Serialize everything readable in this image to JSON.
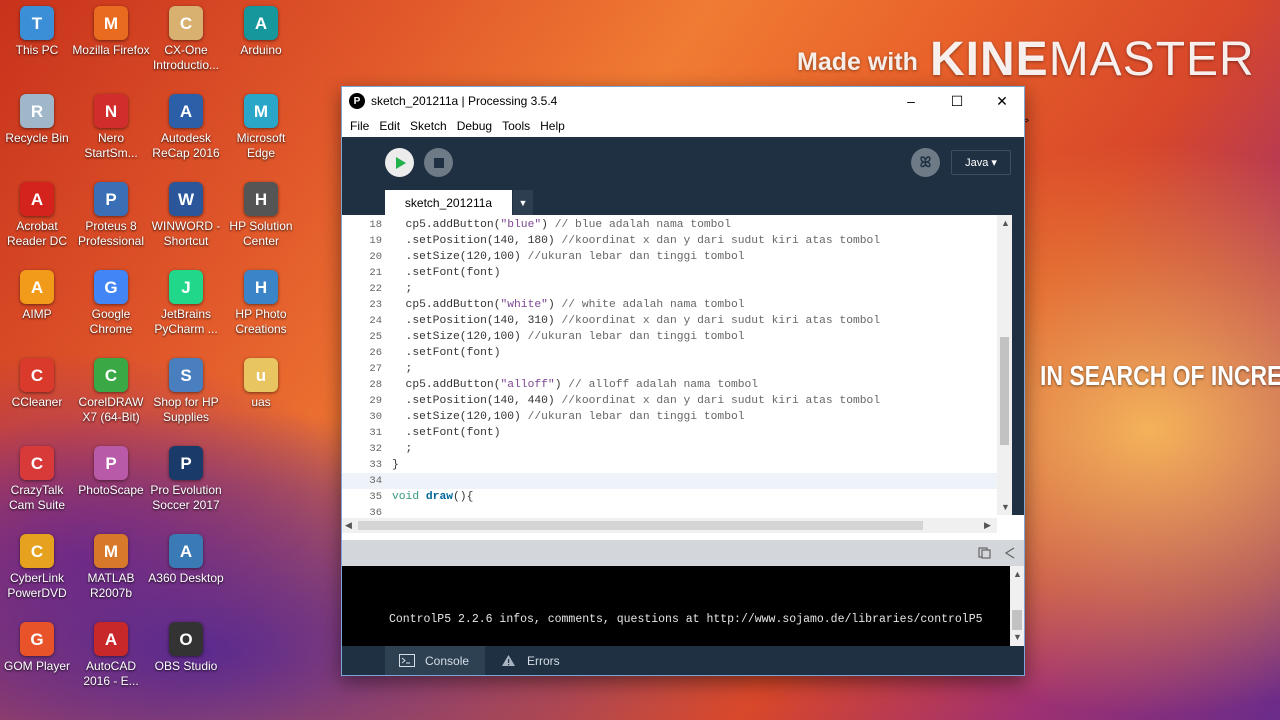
{
  "desktop": {
    "icons": [
      {
        "label": "This PC",
        "icon": "computer-icon",
        "color": "#3b8fd6"
      },
      {
        "label": "Mozilla Firefox",
        "icon": "firefox-icon",
        "color": "#e86b1f"
      },
      {
        "label": "CX-One Introductio...",
        "icon": "document-icon",
        "color": "#d8b070"
      },
      {
        "label": "Arduino",
        "icon": "arduino-icon",
        "color": "#16979c"
      },
      {
        "label": "Recycle Bin",
        "icon": "recycle-bin-icon",
        "color": "#9fb7c9"
      },
      {
        "label": "Nero StartSm...",
        "icon": "nero-icon",
        "color": "#d22d2d"
      },
      {
        "label": "Autodesk ReCap 2016",
        "icon": "recap-icon",
        "color": "#2b5fa8"
      },
      {
        "label": "Microsoft Edge",
        "icon": "edge-icon",
        "color": "#2aa6c9"
      },
      {
        "label": "Acrobat Reader DC",
        "icon": "acrobat-icon",
        "color": "#d4231c"
      },
      {
        "label": "Proteus 8 Professional",
        "icon": "proteus-icon",
        "color": "#3a6fb5"
      },
      {
        "label": "WINWORD - Shortcut",
        "icon": "word-icon",
        "color": "#2b579a"
      },
      {
        "label": "HP Solution Center",
        "icon": "hp-solution-icon",
        "color": "#555555"
      },
      {
        "label": "AIMP",
        "icon": "aimp-icon",
        "color": "#f29b1a"
      },
      {
        "label": "Google Chrome",
        "icon": "chrome-icon",
        "color": "#4285f4"
      },
      {
        "label": "JetBrains PyCharm ...",
        "icon": "pycharm-icon",
        "color": "#21d789"
      },
      {
        "label": "HP Photo Creations",
        "icon": "hp-photo-icon",
        "color": "#3a84c7"
      },
      {
        "label": "CCleaner",
        "icon": "ccleaner-icon",
        "color": "#d93a2b"
      },
      {
        "label": "CorelDRAW X7 (64-Bit)",
        "icon": "coreldraw-icon",
        "color": "#3aa845"
      },
      {
        "label": "Shop for HP Supplies",
        "icon": "hp-shop-icon",
        "color": "#4a7fbf"
      },
      {
        "label": "uas",
        "icon": "folder-icon",
        "color": "#e8c560"
      },
      {
        "label": "CrazyTalk Cam Suite",
        "icon": "crazytalk-icon",
        "color": "#d83a3a"
      },
      {
        "label": "PhotoScape",
        "icon": "photoscape-icon",
        "color": "#b85aa8"
      },
      {
        "label": "Pro Evolution Soccer 2017",
        "icon": "pes-icon",
        "color": "#1a3a6a"
      },
      {
        "label": "",
        "icon": "",
        "color": ""
      },
      {
        "label": "CyberLink PowerDVD",
        "icon": "powerdvd-icon",
        "color": "#e6a21f"
      },
      {
        "label": "MATLAB R2007b",
        "icon": "matlab-icon",
        "color": "#d7782a"
      },
      {
        "label": "A360 Desktop",
        "icon": "a360-icon",
        "color": "#3a7ab5"
      },
      {
        "label": "",
        "icon": "",
        "color": ""
      },
      {
        "label": "GOM Player",
        "icon": "gom-player-icon",
        "color": "#e8532a"
      },
      {
        "label": "AutoCAD 2016 - E...",
        "icon": "autocad-icon",
        "color": "#c8282a"
      },
      {
        "label": "OBS Studio",
        "icon": "obs-icon",
        "color": "#333333"
      }
    ]
  },
  "watermark": {
    "made_with": "Made with",
    "kine": "KINE",
    "master": "MASTER"
  },
  "side_text": "IN SEARCH OF INCRED",
  "window": {
    "title": "sketch_201211a | Processing 3.5.4",
    "app_icon_glyph": "P",
    "minimize": "–",
    "maximize": "☐",
    "close": "✕",
    "menu": [
      "File",
      "Edit",
      "Sketch",
      "Debug",
      "Tools",
      "Help"
    ],
    "mode": "Java ▾",
    "debug_glyph": "ꕤ",
    "tab_name": "sketch_201211a",
    "tab_menu": "▼"
  },
  "code_lines": [
    {
      "n": "18",
      "text": "  cp5.addButton(\"blue\") // blue adalah nama tombol"
    },
    {
      "n": "19",
      "text": "  .setPosition(140, 180) //koordinat x dan y dari sudut kiri atas tombol"
    },
    {
      "n": "20",
      "text": "  .setSize(120,100) //ukuran lebar dan tinggi tombol"
    },
    {
      "n": "21",
      "text": "  .setFont(font)"
    },
    {
      "n": "22",
      "text": "  ;"
    },
    {
      "n": "23",
      "text": "  cp5.addButton(\"white\") // white adalah nama tombol"
    },
    {
      "n": "24",
      "text": "  .setPosition(140, 310) //koordinat x dan y dari sudut kiri atas tombol"
    },
    {
      "n": "25",
      "text": "  .setSize(120,100) //ukuran lebar dan tinggi tombol"
    },
    {
      "n": "26",
      "text": "  .setFont(font)"
    },
    {
      "n": "27",
      "text": "  ;"
    },
    {
      "n": "28",
      "text": "  cp5.addButton(\"alloff\") // alloff adalah nama tombol"
    },
    {
      "n": "29",
      "text": "  .setPosition(140, 440) //koordinat x dan y dari sudut kiri atas tombol"
    },
    {
      "n": "30",
      "text": "  .setSize(120,100) //ukuran lebar dan tinggi tombol"
    },
    {
      "n": "31",
      "text": "  .setFont(font)"
    },
    {
      "n": "32",
      "text": "  ;"
    },
    {
      "n": "33",
      "text": "}"
    },
    {
      "n": "34",
      "text": ""
    },
    {
      "n": "35",
      "text": "void draw(){"
    },
    {
      "n": "36",
      "text": ""
    }
  ],
  "highlight_line": "34",
  "console": {
    "text": "ControlP5 2.2.6 infos, comments, questions at http://www.sojamo.de/libraries/controlP5"
  },
  "footer": {
    "console_label": "Console",
    "errors_label": "Errors"
  },
  "colors": {
    "editor_bg": "#1f3042",
    "run_button": "#ececec",
    "keyword": "#33997e",
    "string": "#7d4793",
    "comment": "#666666"
  }
}
